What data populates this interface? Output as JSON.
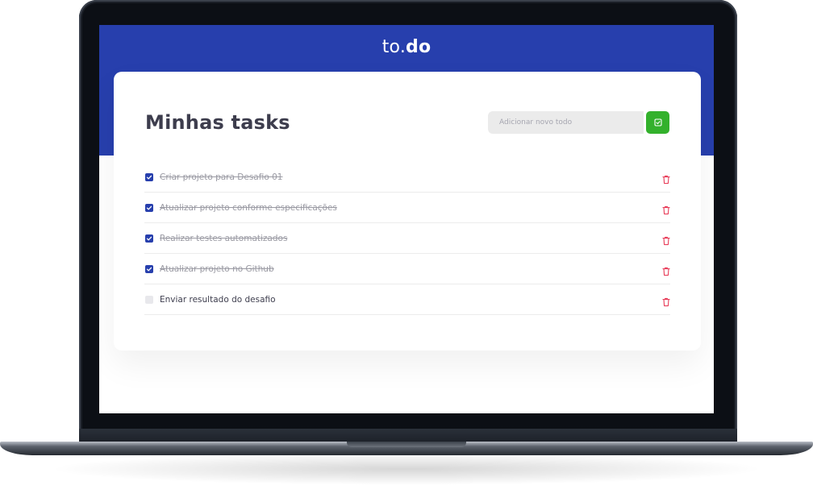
{
  "app": {
    "logo_prefix": "to.",
    "logo_bold": "do"
  },
  "main": {
    "title": "Minhas tasks",
    "input_placeholder": "Adicionar novo todo"
  },
  "colors": {
    "header": "#273fad",
    "add_button": "#33b12c",
    "checkbox_done": "#273fad",
    "trash_icon": "#e83f5b"
  },
  "tasks": [
    {
      "label": "Criar projeto para Desafio 01",
      "done": true
    },
    {
      "label": "Atualizar projeto conforme especificações",
      "done": true
    },
    {
      "label": "Realizar testes automatizados",
      "done": true
    },
    {
      "label": "Atualizar projeto no Github",
      "done": true
    },
    {
      "label": "Enviar resultado do desafio",
      "done": false
    }
  ]
}
